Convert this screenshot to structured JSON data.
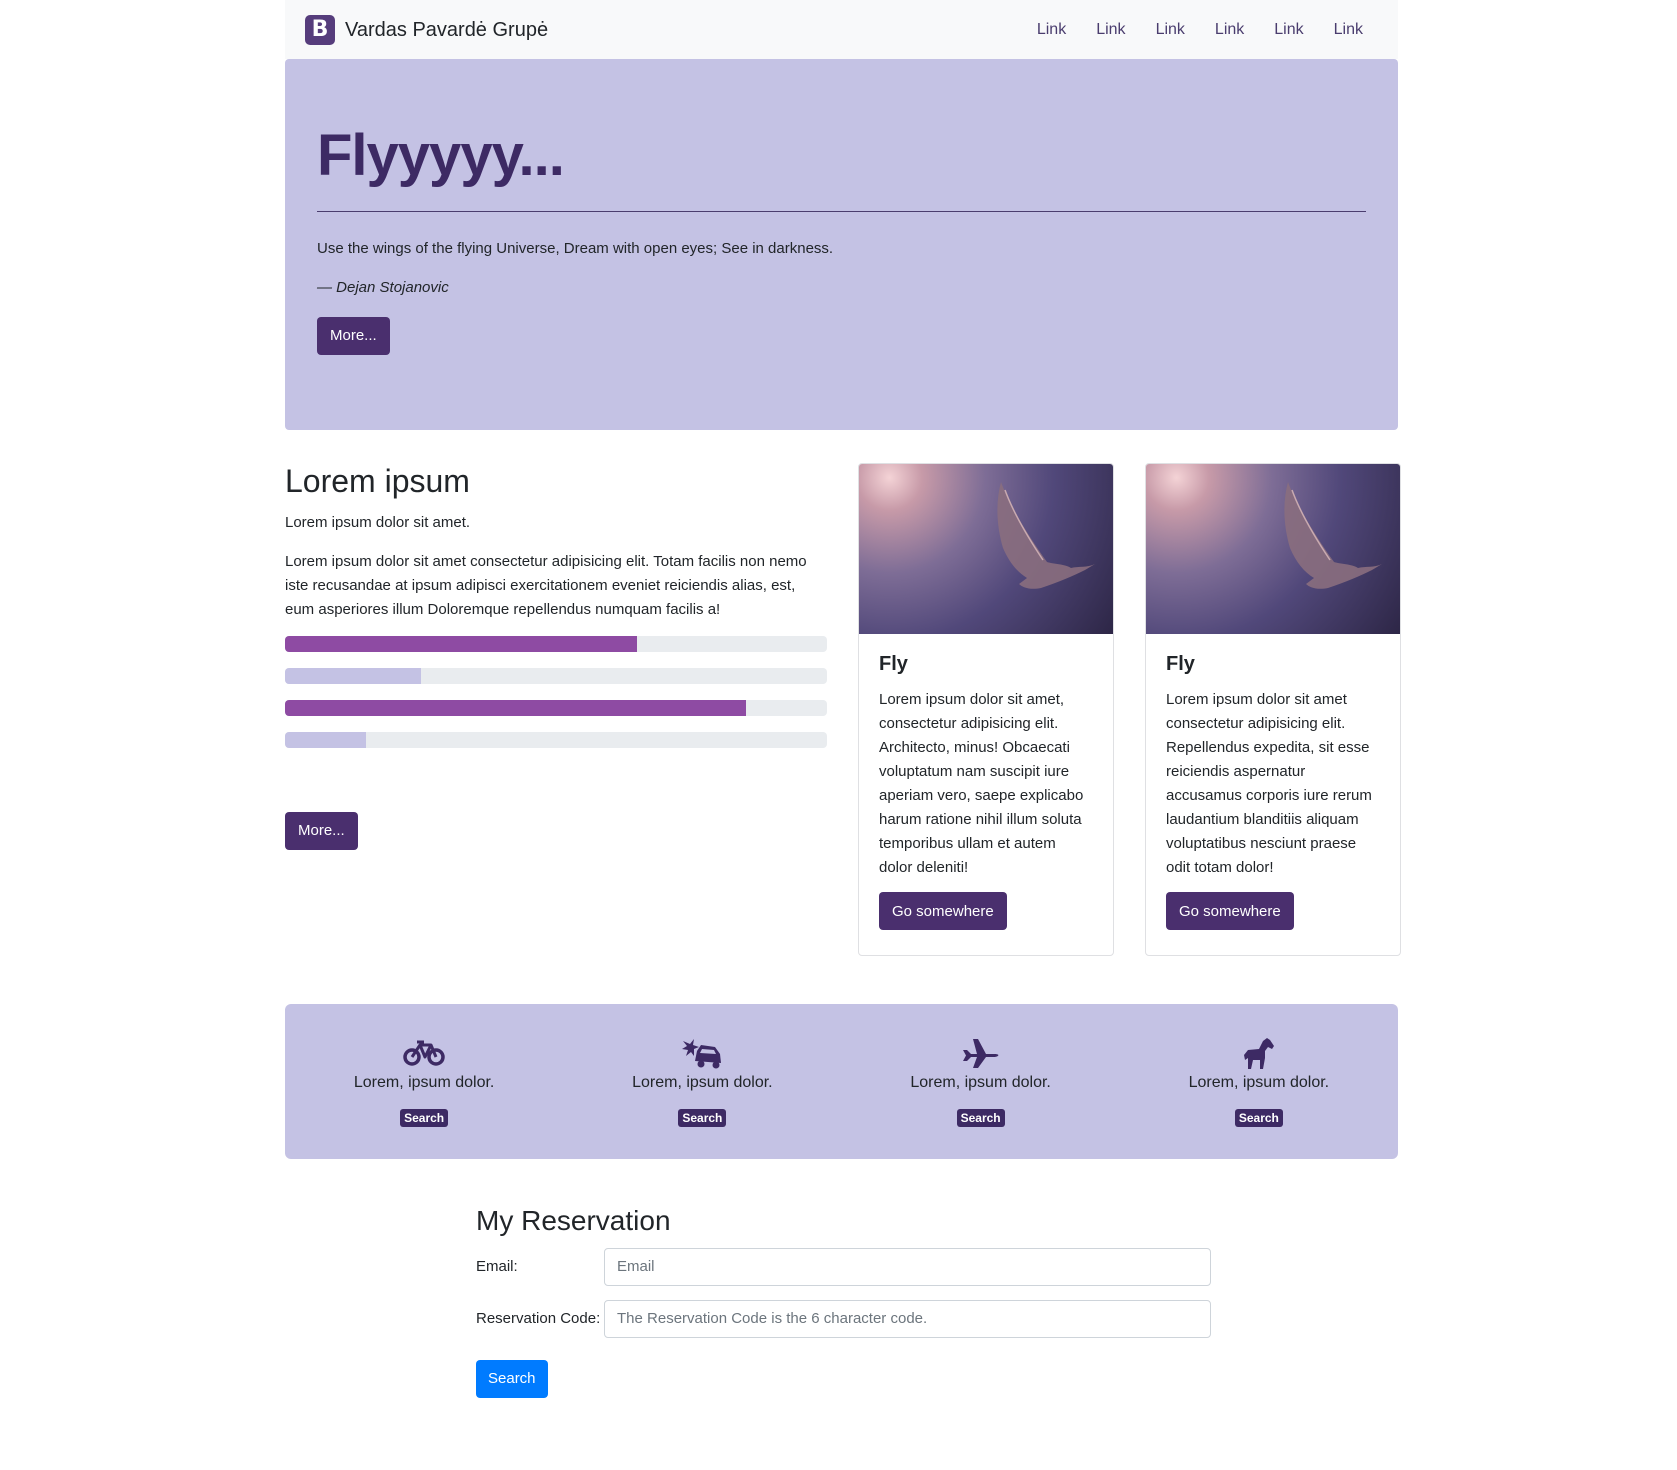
{
  "navbar": {
    "brand_letter": "B",
    "brand_name": "Vardas Pavardė Grupė",
    "links": [
      "Link",
      "Link",
      "Link",
      "Link",
      "Link",
      "Link"
    ]
  },
  "hero": {
    "title": "Flyyyyy...",
    "quote": "Use the wings of the flying Universe, Dream with open eyes; See in darkness.",
    "author": "— Dejan Stojanovic",
    "button": "More..."
  },
  "intro": {
    "heading": "Lorem ipsum",
    "lead": "Lorem ipsum dolor sit amet.",
    "paragraph": "Lorem ipsum dolor sit amet consectetur adipisicing elit. Totam facilis non nemo iste recusandae at ipsum adipisci exercitationem eveniet reiciendis alias, est, eum asperiores illum Doloremque repellendus numquam facilis a!",
    "progress": [
      {
        "value": 65,
        "color": "#8e4ba3"
      },
      {
        "value": 25,
        "color": "#c4c2e4"
      },
      {
        "value": 85,
        "color": "#8e4ba3"
      },
      {
        "value": 15,
        "color": "#c4c2e4"
      }
    ],
    "button": "More..."
  },
  "cards": [
    {
      "title": "Fly",
      "text": "Lorem ipsum dolor sit amet, consectetur adipisicing elit. Architecto, minus! Obcaecati voluptatum nam suscipit iure aperiam vero, saepe explicabo harum ratione nihil illum soluta temporibus ullam et autem dolor deleniti!",
      "button": "Go somewhere"
    },
    {
      "title": "Fly",
      "text": "Lorem ipsum dolor sit amet consectetur adipisicing elit. Repellendus expedita, sit esse reiciendis aspernatur accusamus corporis iure rerum laudantium blanditiis aliquam voluptatibus nesciunt praese odit totam dolor!",
      "button": "Go somewhere"
    }
  ],
  "features": [
    {
      "icon": "bicycle-icon",
      "text": "Lorem, ipsum dolor.",
      "button": "Search"
    },
    {
      "icon": "car-crash-icon",
      "text": "Lorem, ipsum dolor.",
      "button": "Search"
    },
    {
      "icon": "plane-icon",
      "text": "Lorem, ipsum dolor.",
      "button": "Search"
    },
    {
      "icon": "horse-icon",
      "text": "Lorem, ipsum dolor.",
      "button": "Search"
    }
  ],
  "reservation": {
    "heading": "My Reservation",
    "email_label": "Email:",
    "email_placeholder": "Email",
    "code_label": "Reservation Code:",
    "code_placeholder": "The Reservation Code is the 6 character code.",
    "button": "Search"
  },
  "colors": {
    "brand": "#563d7c",
    "band": "#c4c2e4",
    "button_purple": "#4a2f6e",
    "button_blue": "#007bff"
  }
}
